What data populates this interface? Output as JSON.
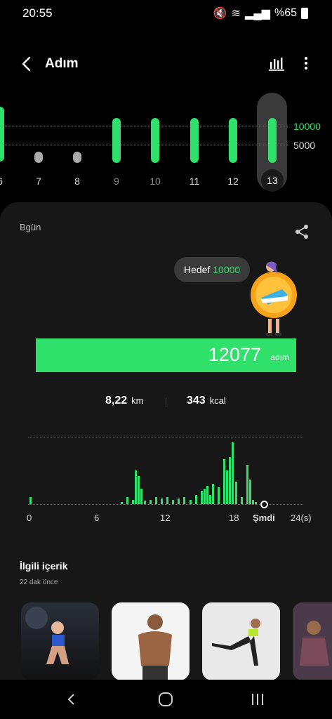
{
  "status": {
    "time": "20:55",
    "battery": "%65"
  },
  "header": {
    "title": "Adım"
  },
  "week": {
    "goal_high": "10000",
    "goal_low": "5000",
    "days": [
      {
        "label": "6",
        "met": true
      },
      {
        "label": "7",
        "met": false
      },
      {
        "label": "8",
        "met": false
      },
      {
        "label": "9",
        "met": true
      },
      {
        "label": "10",
        "met": true
      },
      {
        "label": "11",
        "met": true
      },
      {
        "label": "12",
        "met": true
      },
      {
        "label": "13",
        "met": true,
        "selected": true
      }
    ]
  },
  "today": {
    "label": "Bgün",
    "goal_prefix": "Hedef",
    "goal_value": "10000",
    "steps": "12077",
    "steps_unit": "adım",
    "distance": "8,22",
    "distance_unit": "km",
    "calories": "343",
    "calories_unit": "kcal"
  },
  "chart_data": {
    "type": "bar",
    "x_labels": [
      "0",
      "6",
      "12",
      "18",
      "Şmdi",
      "24(s)"
    ],
    "x": [
      "00:00",
      "08:00",
      "08:30",
      "09:00",
      "09:15",
      "09:30",
      "09:45",
      "10:00",
      "10:30",
      "11:00",
      "11:30",
      "12:00",
      "12:30",
      "13:00",
      "13:30",
      "14:00",
      "14:30",
      "15:00",
      "15:15",
      "15:30",
      "15:45",
      "16:00",
      "16:30",
      "17:00",
      "17:15",
      "17:30",
      "17:45",
      "18:00",
      "18:30",
      "19:00",
      "19:15",
      "19:30",
      "19:45"
    ],
    "values": [
      6,
      2,
      6,
      4,
      30,
      25,
      14,
      3,
      4,
      6,
      5,
      6,
      4,
      5,
      6,
      4,
      8,
      12,
      14,
      16,
      8,
      18,
      15,
      40,
      30,
      42,
      55,
      20,
      6,
      35,
      22,
      4,
      2
    ],
    "ylabel": "",
    "grid": true
  },
  "related": {
    "title": "İlgili içerik",
    "time_ago": "22 dak önce"
  }
}
